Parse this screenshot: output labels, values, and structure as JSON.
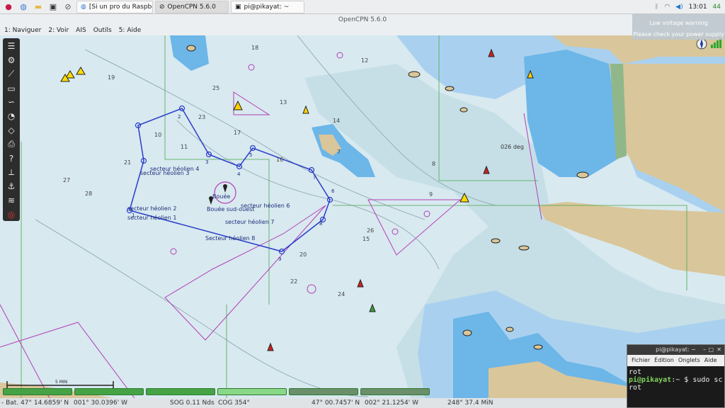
{
  "taskbar": {
    "windows": [
      {
        "label": "[Si un pro du Raspber..."
      },
      {
        "label": "OpenCPN 5.6.0"
      },
      {
        "label": "pi@pikayat: ~"
      }
    ],
    "clock": "13:01",
    "battery": "44"
  },
  "window": {
    "title": "OpenCPN 5.6.0"
  },
  "menu": [
    "1: Naviguer",
    "2: Voir",
    "AIS",
    "Outils",
    "5: Aide"
  ],
  "warning": {
    "line1": "Low voltage warning",
    "line2": "Please check your power supply"
  },
  "route": {
    "waypoints": [
      "1",
      "2",
      "3",
      "4",
      "5",
      "6",
      "7",
      "8",
      "9"
    ],
    "labels": [
      "secteur héolien 4",
      "secteur héolien 3",
      "secteur héolien 2",
      "secteur héolien 1",
      "Bouée",
      "Bouée sud-ouest",
      "secteur héolien 6",
      "secteur héolien 7",
      "Secteur héolien 8"
    ]
  },
  "chart_labels": {
    "bearing": "026 deg",
    "scale": "5 MIN"
  },
  "depths": [
    "18",
    "19",
    "21",
    "23",
    "25",
    "27",
    "12",
    "14",
    "15",
    "16",
    "17",
    "20",
    "22",
    "24",
    "26",
    "28",
    "13",
    "11",
    "10",
    "7",
    "8",
    "9"
  ],
  "terminal": {
    "title": "pi@pikayat: ~",
    "menu": [
      "Fichier",
      "Édition",
      "Onglets",
      "Aide"
    ],
    "line1": "rot",
    "prompt": "pi@pikayat",
    "cmd": ":~ $ sudo sc",
    "line3": "rot"
  },
  "status": {
    "bat": "- Bat. 47° 14.6859' N",
    "lon": "001° 30.0396' W",
    "sog": "SOG 0.11 Nds",
    "cog": "COG 354°",
    "cur_lat": "47° 00.7457' N",
    "cur_lon": "002° 21.1254' W",
    "brg": "248°  37.4 MiN"
  },
  "colors": {
    "sea": "#d8e9f0",
    "shallow": "#a9d1ef",
    "deep_shallow": "#6cb6e8",
    "land": "#d9c69a",
    "route": "#2a3ec9",
    "magenta": "#b33fb5"
  }
}
